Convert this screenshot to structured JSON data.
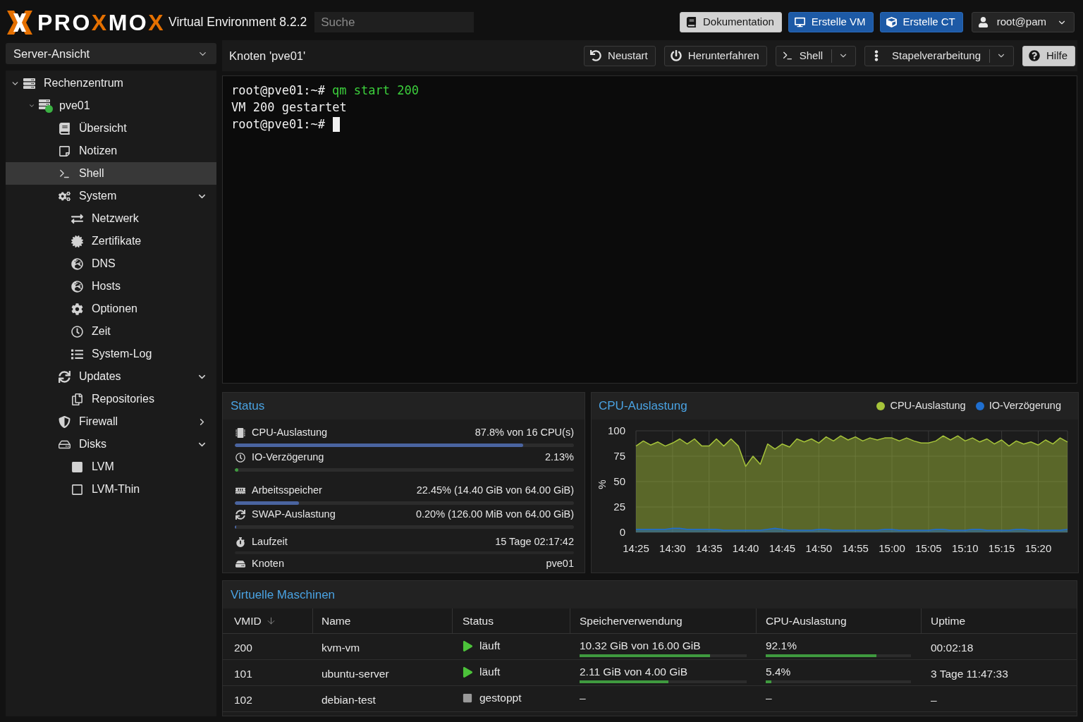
{
  "header": {
    "logo_wordmark": [
      {
        "text": "PRO",
        "accent": false
      },
      {
        "text": "X",
        "accent": true
      },
      {
        "text": "MO",
        "accent": false
      },
      {
        "text": "X",
        "accent": true
      }
    ],
    "product": "Virtual Environment 8.2.2",
    "search": {
      "placeholder": "Suche"
    },
    "buttons": [
      {
        "label": "Dokumentation",
        "kind": "light"
      },
      {
        "label": "Erstelle VM",
        "kind": "primary"
      },
      {
        "label": "Erstelle CT",
        "kind": "primary"
      },
      {
        "label": "root@pam",
        "kind": "menu"
      }
    ]
  },
  "view_selector": {
    "value": "Server-Ansicht"
  },
  "tree": [
    {
      "label": "Rechenzentrum",
      "selected": false,
      "expanded": true,
      "children": [
        {
          "label": "pve01",
          "selected": false,
          "expanded": true,
          "children": [
            {
              "label": "Übersicht",
              "selected": false
            },
            {
              "label": "Notizen",
              "selected": false
            },
            {
              "label": "Shell",
              "selected": true
            },
            {
              "label": "System",
              "selected": false,
              "expanded": true,
              "children": [
                {
                  "label": "Netzwerk",
                  "selected": false
                },
                {
                  "label": "Zertifikate",
                  "selected": false
                },
                {
                  "label": "DNS",
                  "selected": false
                },
                {
                  "label": "Hosts",
                  "selected": false
                },
                {
                  "label": "Optionen",
                  "selected": false
                },
                {
                  "label": "Zeit",
                  "selected": false
                },
                {
                  "label": "System-Log",
                  "selected": false
                }
              ]
            },
            {
              "label": "Updates",
              "selected": false,
              "expanded": true,
              "children": [
                {
                  "label": "Repositories",
                  "selected": false
                }
              ]
            },
            {
              "label": "Firewall",
              "selected": false,
              "expanded": false
            },
            {
              "label": "Disks",
              "selected": false,
              "expanded": true,
              "children": [
                {
                  "label": "LVM",
                  "selected": false
                },
                {
                  "label": "LVM-Thin",
                  "selected": false
                }
              ]
            }
          ]
        }
      ]
    }
  ],
  "content_header": {
    "title": "Knoten 'pve01'",
    "buttons": [
      {
        "label": "Neustart",
        "kind": "plain"
      },
      {
        "label": "Herunterfahren",
        "kind": "plain"
      },
      {
        "label": "Shell",
        "kind": "split"
      },
      {
        "label": "Stapelverarbeitung",
        "kind": "split"
      },
      {
        "label": "Hilfe",
        "kind": "light"
      }
    ]
  },
  "terminal": {
    "lines": [
      {
        "kind": "prompt",
        "prompt": "root@pve01:~#",
        "command": "qm start 200",
        "cursor": false
      },
      {
        "kind": "output",
        "text": "VM 200 gestartet"
      },
      {
        "kind": "prompt",
        "prompt": "root@pve01:~#",
        "cursor": true
      }
    ]
  },
  "status_panel": {
    "title": "Status",
    "rows": [
      {
        "label": "CPU-Auslastung",
        "value": "87.8% von 16 CPU(s)",
        "level": 0.85,
        "color": "#4a64a0"
      },
      {
        "label": "IO-Verzögerung",
        "value": "2.13%",
        "level": 0.01,
        "color": "#3f9a3f"
      },
      {
        "label": "Arbeitsspeicher",
        "value": "22.45% (14.40 GiB von 64.00 GiB)",
        "level": 0.19,
        "color": "#4a64a0"
      },
      {
        "label": "SWAP-Auslastung",
        "value": "0.20% (126.00 MiB von 64.00 GiB)",
        "level": 0.004,
        "color": "#4a64a0"
      },
      {
        "label": "Laufzeit",
        "value": "15 Tage 02:17:42"
      },
      {
        "label": "Knoten",
        "value": "pve01"
      }
    ]
  },
  "cpu_panel": {
    "chart_data": {
      "type": "area",
      "title": "CPU-Auslastung",
      "ylabel": "%",
      "categories": [
        "14:25",
        null,
        null,
        null,
        null,
        "14:30",
        null,
        null,
        null,
        null,
        "14:35",
        null,
        null,
        null,
        null,
        "14:40",
        null,
        null,
        null,
        null,
        "14:45",
        null,
        null,
        null,
        null,
        "14:50",
        null,
        null,
        null,
        null,
        "14:55",
        null,
        null,
        null,
        null,
        "15:00",
        null,
        null,
        null,
        null,
        "15:05",
        null,
        null,
        null,
        null,
        "15:10",
        null,
        null,
        null,
        null,
        "15:15",
        null,
        null,
        null,
        null,
        "15:20",
        null,
        null,
        null,
        null
      ],
      "series": [
        {
          "name": "CPU-Auslastung",
          "color": "#a6c43a",
          "values": [
            85,
            90,
            86,
            89,
            85,
            88,
            92,
            87,
            92,
            85,
            85,
            92,
            85,
            92,
            85,
            65,
            75,
            67,
            87,
            82,
            87,
            84,
            92,
            89,
            92,
            88,
            94,
            90,
            95,
            91,
            94,
            90,
            93,
            91,
            93,
            93,
            90,
            93,
            90,
            88,
            88,
            90,
            95,
            91,
            95,
            90,
            93,
            89,
            92,
            87,
            91,
            85,
            90,
            87,
            89,
            86,
            91,
            87,
            93,
            89
          ]
        },
        {
          "name": "IO-Verzögerung",
          "color": "#1f6fd0",
          "values": [
            3,
            3,
            3,
            3,
            3,
            4,
            4,
            3,
            3,
            3,
            3,
            3,
            2,
            2,
            2,
            2,
            2,
            2,
            3,
            4,
            3,
            2,
            2,
            2,
            2,
            3,
            3,
            2,
            2,
            2,
            2,
            2,
            2,
            2,
            3,
            3,
            2,
            2,
            2,
            2,
            2,
            3,
            3,
            2,
            2,
            2,
            3,
            3,
            2,
            2,
            2,
            2,
            3,
            3,
            2,
            2,
            2,
            2,
            2,
            3
          ]
        }
      ],
      "ylim": [
        0,
        100
      ],
      "yticks": [
        0,
        25,
        50,
        75,
        100
      ],
      "grid": true
    }
  },
  "vm_panel": {
    "title": "Virtuelle Maschinen",
    "columns": [
      {
        "label": "VMID",
        "sorted": true
      },
      {
        "label": "Name",
        "sorted": false
      },
      {
        "label": "Status",
        "sorted": false
      },
      {
        "label": "Speicherverwendung",
        "sorted": false
      },
      {
        "label": "CPU-Auslastung",
        "sorted": false
      },
      {
        "label": "Uptime",
        "sorted": false
      }
    ],
    "rows": [
      {
        "vmid": "200",
        "name": "kvm-vm",
        "status": {
          "kind": "running",
          "text": "läuft"
        },
        "memory": {
          "text": "10.32 GiB von 16.00 GiB",
          "level": 0.78
        },
        "cpu": {
          "text": "92.1%",
          "level": 0.76
        },
        "uptime": "00:02:18"
      },
      {
        "vmid": "101",
        "name": "ubuntu-server",
        "status": {
          "kind": "running",
          "text": "läuft"
        },
        "memory": {
          "text": "2.11 GiB von 4.00 GiB",
          "level": 0.53
        },
        "cpu": {
          "text": "5.4%",
          "level": 0.04
        },
        "uptime": "3 Tage 11:47:33"
      },
      {
        "vmid": "102",
        "name": "debian-test",
        "status": {
          "kind": "stopped",
          "text": "gestoppt"
        },
        "memory": {
          "text": "–"
        },
        "cpu": {
          "text": "–"
        },
        "uptime": "–"
      }
    ]
  }
}
